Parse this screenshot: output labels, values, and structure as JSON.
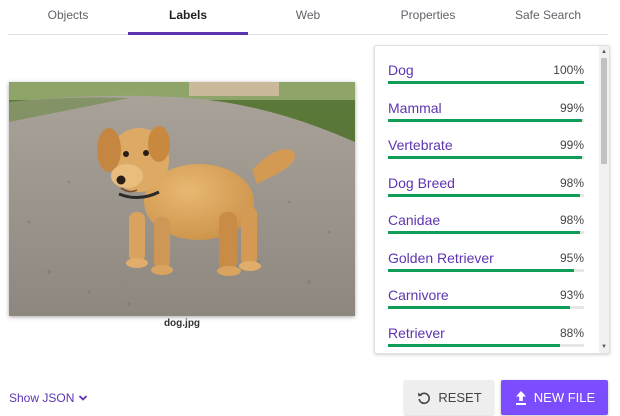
{
  "tabs": [
    "Objects",
    "Labels",
    "Web",
    "Properties",
    "Safe Search"
  ],
  "active_tab": "Labels",
  "image": {
    "caption": "dog.jpg"
  },
  "labels": [
    {
      "name": "Dog",
      "score_text": "100%",
      "score": 1.0
    },
    {
      "name": "Mammal",
      "score_text": "99%",
      "score": 0.99
    },
    {
      "name": "Vertebrate",
      "score_text": "99%",
      "score": 0.99
    },
    {
      "name": "Dog Breed",
      "score_text": "98%",
      "score": 0.98
    },
    {
      "name": "Canidae",
      "score_text": "98%",
      "score": 0.98
    },
    {
      "name": "Golden Retriever",
      "score_text": "95%",
      "score": 0.95
    },
    {
      "name": "Carnivore",
      "score_text": "93%",
      "score": 0.93
    },
    {
      "name": "Retriever",
      "score_text": "88%",
      "score": 0.88
    }
  ],
  "colors": {
    "accent": "#5e35b1",
    "bar": "#0f9d58",
    "primary_button": "#7c4dff"
  },
  "controls": {
    "show_json": "Show JSON",
    "show_json_icon": "chevron-down-icon",
    "reset": "RESET",
    "reset_icon": "reset-icon",
    "new_file": "NEW FILE",
    "new_file_icon": "upload-icon"
  }
}
